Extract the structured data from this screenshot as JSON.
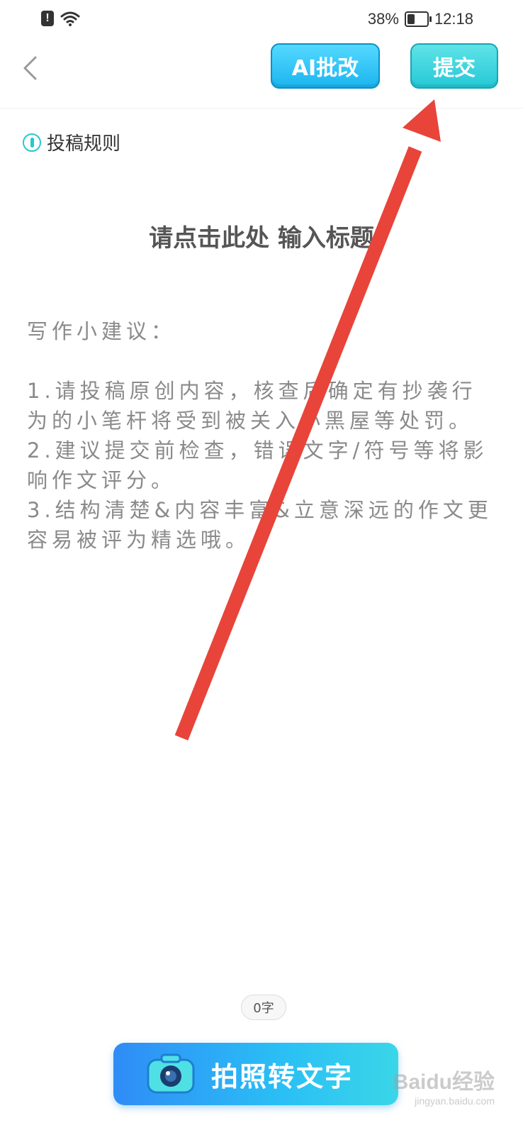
{
  "status_bar": {
    "battery_percent_text": "38%",
    "battery_level": 0.38,
    "time": "12:18",
    "left_icons": [
      "alert-icon",
      "wifi-icon"
    ]
  },
  "header": {
    "back_icon": "chevron-left-icon",
    "ai_button_label": "AI批改",
    "submit_button_label": "提交",
    "ai_button_color": "#1bb5f0",
    "submit_button_color": "#26c8d6"
  },
  "rules": {
    "label": "投稿规则",
    "icon": "info-icon",
    "icon_color": "#28c7d2"
  },
  "editor": {
    "title_placeholder": "请点击此处 输入标题",
    "tips_heading": "写作小建议：",
    "tips": [
      "1.请投稿原创内容，核查后确定有抄袭行为的小笔杆将受到被关入小黑屋等处罚。",
      "2.建议提交前检查，错误文字/符号等将影响作文评分。",
      "3.结构清楚&内容丰富&立意深远的作文更容易被评为精选哦。"
    ]
  },
  "footer": {
    "word_count": "0字",
    "photo_button_label": "拍照转文字",
    "photo_icon": "camera-icon"
  },
  "annotation": {
    "arrow_color": "#e8443a"
  },
  "watermark": {
    "logo": "Baidu经验",
    "url": "jingyan.baidu.com"
  }
}
